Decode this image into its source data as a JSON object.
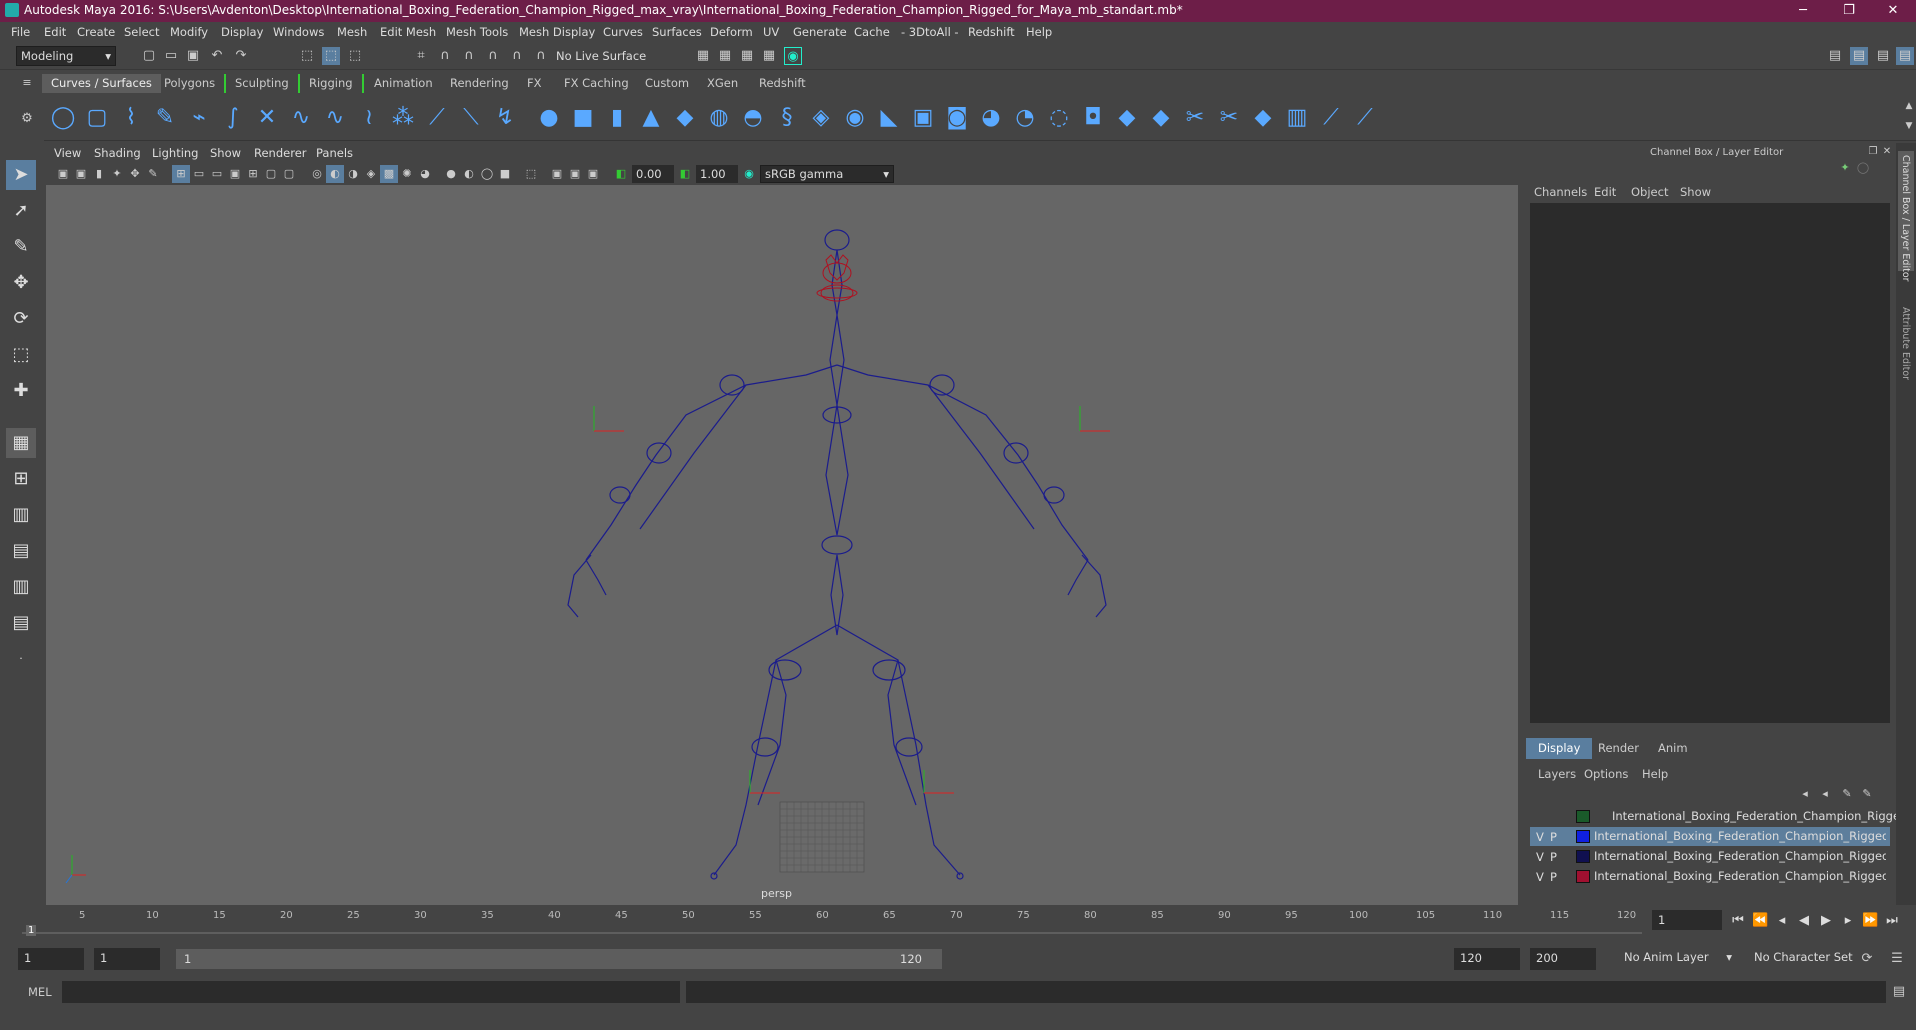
{
  "window": {
    "title": "Autodesk Maya 2016: S:\\Users\\Avdenton\\Desktop\\International_Boxing_Federation_Champion_Rigged_max_vray\\International_Boxing_Federation_Champion_Rigged_for_Maya_mb_standart.mb*",
    "minimize": "─",
    "maximize": "❐",
    "close": "✕"
  },
  "menus": [
    "File",
    "Edit",
    "Create",
    "Select",
    "Modify",
    "Display",
    "Windows",
    "Mesh",
    "Edit Mesh",
    "Mesh Tools",
    "Mesh Display",
    "Curves",
    "Surfaces",
    "Deform",
    "UV",
    "Generate",
    "Cache",
    "- 3DtoAll -",
    "Redshift",
    "Help"
  ],
  "status": {
    "mode": "Modeling",
    "live_surface": "No Live Surface"
  },
  "shelf_tabs": [
    "Curves / Surfaces",
    "Polygons",
    "Sculpting",
    "Rigging",
    "Animation",
    "Rendering",
    "FX",
    "FX Caching",
    "Custom",
    "XGen",
    "Redshift"
  ],
  "viewport": {
    "menus": [
      "View",
      "Shading",
      "Lighting",
      "Show",
      "Renderer",
      "Panels"
    ],
    "exposure": "0.00",
    "gamma": "1.00",
    "color_space": "sRGB gamma",
    "camera_label": "persp"
  },
  "channel_box": {
    "header": "Channel Box / Layer Editor",
    "menus": [
      "Channels",
      "Edit",
      "Object",
      "Show"
    ],
    "side_tabs": [
      "Channel Box / Layer Editor",
      "Attribute Editor"
    ]
  },
  "layer_editor": {
    "tabs": [
      "Display",
      "Render",
      "Anim"
    ],
    "menus": [
      "Layers",
      "Options",
      "Help"
    ],
    "layers": [
      {
        "v": "",
        "p": "",
        "color": "#1a5a2a",
        "name": "International_Boxing_Federation_Champion_Rigged",
        "selected": false
      },
      {
        "v": "V",
        "p": "P",
        "color": "#1020e0",
        "name": "International_Boxing_Federation_Champion_Rigged_CO",
        "selected": true
      },
      {
        "v": "V",
        "p": "P",
        "color": "#101050",
        "name": "International_Boxing_Federation_Champion_Rigged_BO",
        "selected": false
      },
      {
        "v": "V",
        "p": "P",
        "color": "#a01030",
        "name": "International_Boxing_Federation_Champion_Rigged_HEl",
        "selected": false
      }
    ]
  },
  "timeline": {
    "ticks": [
      "5",
      "10",
      "15",
      "20",
      "25",
      "30",
      "35",
      "40",
      "45",
      "50",
      "55",
      "60",
      "65",
      "70",
      "75",
      "80",
      "85",
      "90",
      "95",
      "100",
      "105",
      "110",
      "115",
      "120"
    ],
    "current_frame": "1",
    "start_marker": "1"
  },
  "range": {
    "start": "1",
    "inner_start": "1",
    "slider_start": "1",
    "slider_end": "120",
    "end": "120",
    "anim_end": "200",
    "anim_layer": "No Anim Layer",
    "char_set": "No Character Set"
  },
  "command": {
    "label": "MEL"
  }
}
